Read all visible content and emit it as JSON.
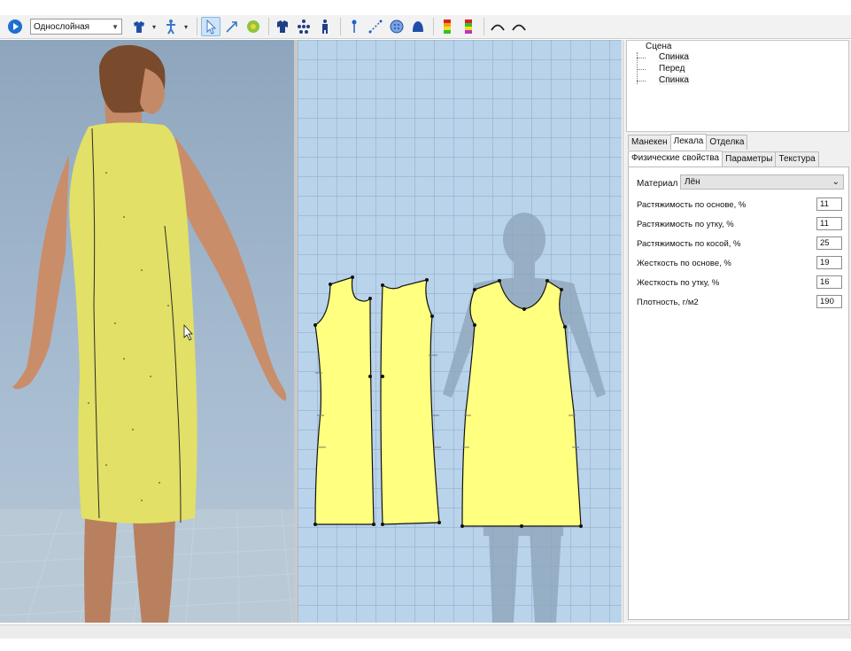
{
  "toolbar": {
    "mode_select": "Однослойная",
    "buttons": [
      "play-icon",
      "shirt-icon",
      "mannequin-icon",
      "select-arrow-icon",
      "draw-arrow-icon",
      "gear-flower-icon",
      "garment-icon",
      "points-icon",
      "figure-icon",
      "pin-icon",
      "measure-icon",
      "button-icon",
      "bell-icon",
      "tension-map-icon",
      "percent-map-icon",
      "curve-left-icon",
      "curve-right-icon"
    ]
  },
  "scene_tree": {
    "root": "Сцена",
    "items": [
      "Спинка",
      "Перед",
      "Спинка"
    ]
  },
  "tabs_top": [
    {
      "label": "Манекен",
      "active": false
    },
    {
      "label": "Лекала",
      "active": true
    },
    {
      "label": "Отделка",
      "active": false
    }
  ],
  "tabs_sub": [
    {
      "label": "Физические свойства",
      "active": true
    },
    {
      "label": "Параметры",
      "active": false
    },
    {
      "label": "Текстура",
      "active": false
    }
  ],
  "properties": {
    "material_label": "Материал",
    "material_value": "Лён",
    "rows": [
      {
        "label": "Растяжимость по основе, %",
        "value": "11"
      },
      {
        "label": "Растяжимость по утку, %",
        "value": "11"
      },
      {
        "label": "Растяжимость по косой, %",
        "value": "25"
      },
      {
        "label": "Жесткость по основе, %",
        "value": "19"
      },
      {
        "label": "Жесткость по утку, %",
        "value": "16"
      },
      {
        "label": "Плотность, г/м2",
        "value": "190"
      }
    ]
  },
  "colors": {
    "fabric": "#ffff80",
    "dress_3d": "#e2e066",
    "grid_bg": "#b9d3ea",
    "view3d_bg": "#a6bbd0"
  }
}
